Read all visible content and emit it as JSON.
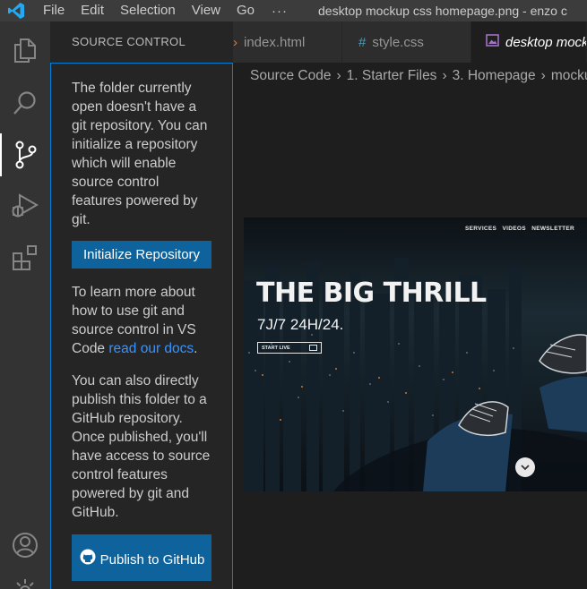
{
  "titlebar": {
    "menu": [
      "File",
      "Edit",
      "Selection",
      "View",
      "Go"
    ],
    "more": "···",
    "window_title": "desktop mockup css homepage.png - enzo c"
  },
  "activitybar": {
    "items": [
      "files-icon",
      "search-icon",
      "source-control-icon",
      "run-debug-icon",
      "extensions-icon",
      "account-icon",
      "settings-gear-icon"
    ]
  },
  "sidebar": {
    "title": "SOURCE CONTROL",
    "intro": "The folder currently open doesn't have a git repository. You can initialize a repository which will enable source control features powered by git.",
    "init_button": "Initialize Repository",
    "learn_prefix": "To learn more about how to use git and source control in VS Code ",
    "learn_link": "read our docs",
    "learn_suffix": ".",
    "publish_text": "You can also directly publish this folder to a GitHub repository. Once published, you'll have access to source control features powered by git and GitHub.",
    "publish_button": "Publish to GitHub"
  },
  "tabs": [
    {
      "icon": "html-icon",
      "glyph": "›",
      "label": "index.html"
    },
    {
      "icon": "css-icon",
      "glyph": "#",
      "label": "style.css"
    },
    {
      "icon": "image-icon",
      "label": "desktop mockup css homepage.png"
    }
  ],
  "breadcrumb": [
    "Source Code",
    "1. Starter Files",
    "3. Homepage",
    "mockup"
  ],
  "mockup": {
    "nav": [
      "SERVICES",
      "VIDEOS",
      "NEWSLETTER"
    ],
    "headline": "THE BIG THRILL",
    "subheadline": "7J/7 24H/24.",
    "cta": "START LIVE"
  },
  "colors": {
    "accent": "#007fd4",
    "button": "#0e639c",
    "link": "#3794ff",
    "activity_bar": "#333333",
    "sidebar": "#252526",
    "editor": "#1e1e1e",
    "titlebar": "#3c3c3c"
  }
}
